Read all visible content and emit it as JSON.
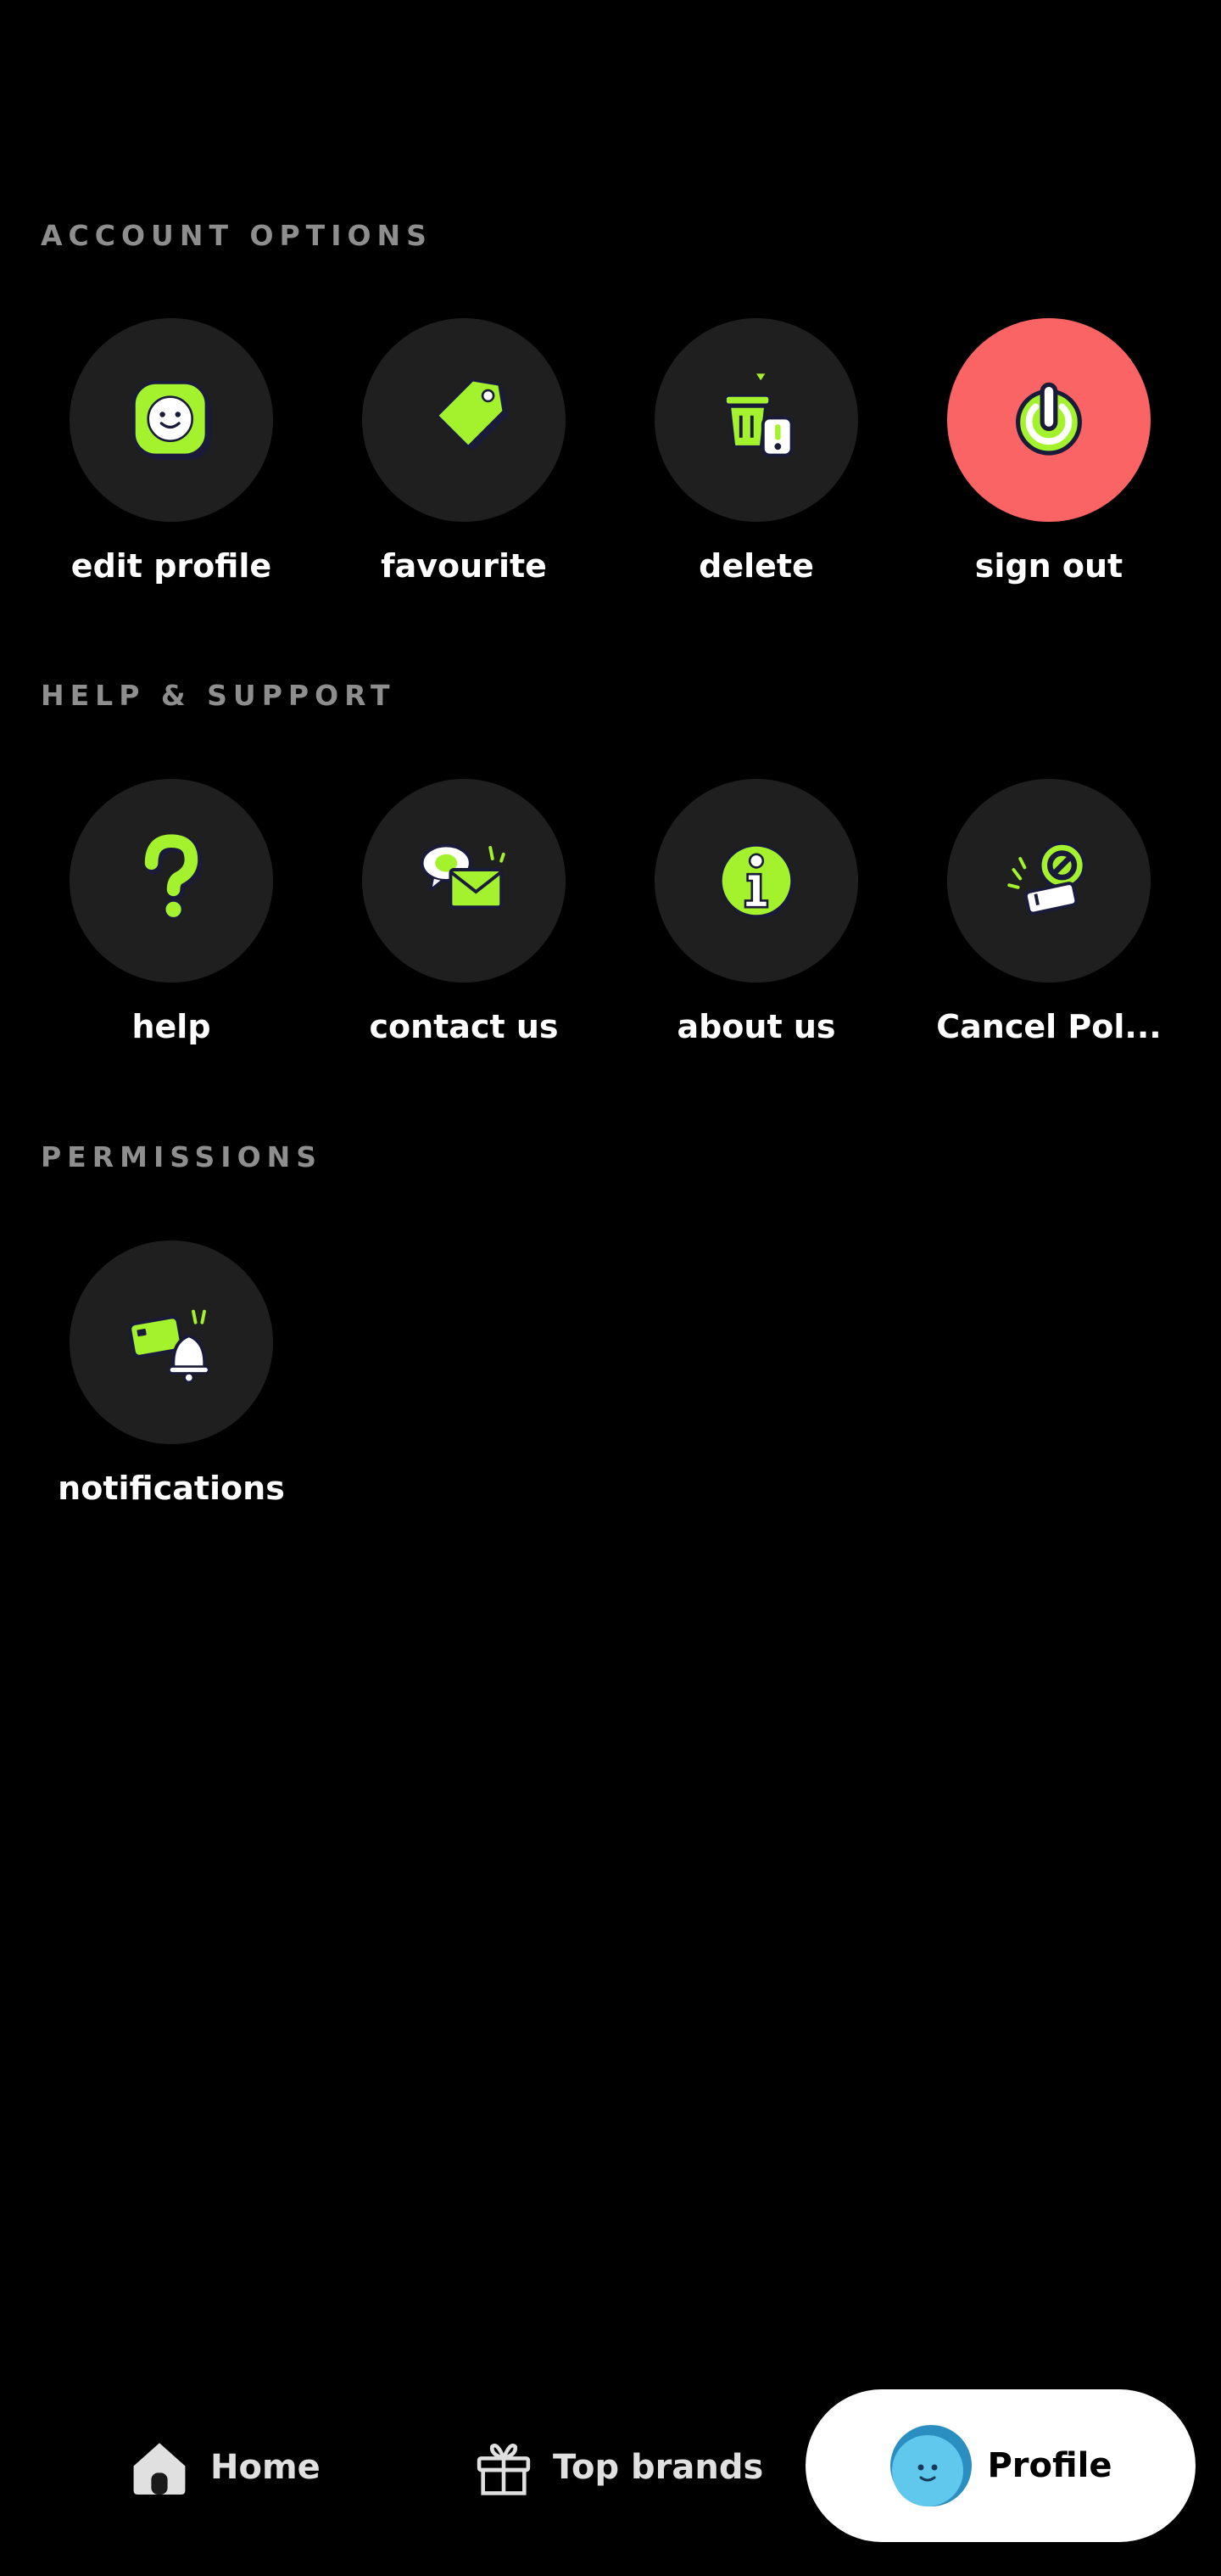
{
  "sections": {
    "account": {
      "title": "ACCOUNT OPTIONS",
      "items": [
        {
          "label": "edit profile",
          "icon": "smiley-face-icon"
        },
        {
          "label": "favourite",
          "icon": "tag-icon"
        },
        {
          "label": "delete",
          "icon": "trash-icon"
        },
        {
          "label": "sign out",
          "icon": "power-icon"
        }
      ]
    },
    "help": {
      "title": "HELP & SUPPORT",
      "items": [
        {
          "label": "help",
          "icon": "question-mark-icon"
        },
        {
          "label": "contact us",
          "icon": "envelope-chat-icon"
        },
        {
          "label": "about us",
          "icon": "info-icon"
        },
        {
          "label": "Cancel Pol...",
          "icon": "cancel-ticket-icon"
        }
      ]
    },
    "permissions": {
      "title": "PERMISSIONS",
      "items": [
        {
          "label": "notifications",
          "icon": "card-bell-icon"
        }
      ]
    }
  },
  "bottom_nav": {
    "home": "Home",
    "top_brands": "Top brands",
    "profile": "Profile"
  },
  "colors": {
    "accent": "#a4f22d",
    "danger": "#fa6464",
    "tile_bg": "#1f1f1f",
    "background": "#000000"
  }
}
